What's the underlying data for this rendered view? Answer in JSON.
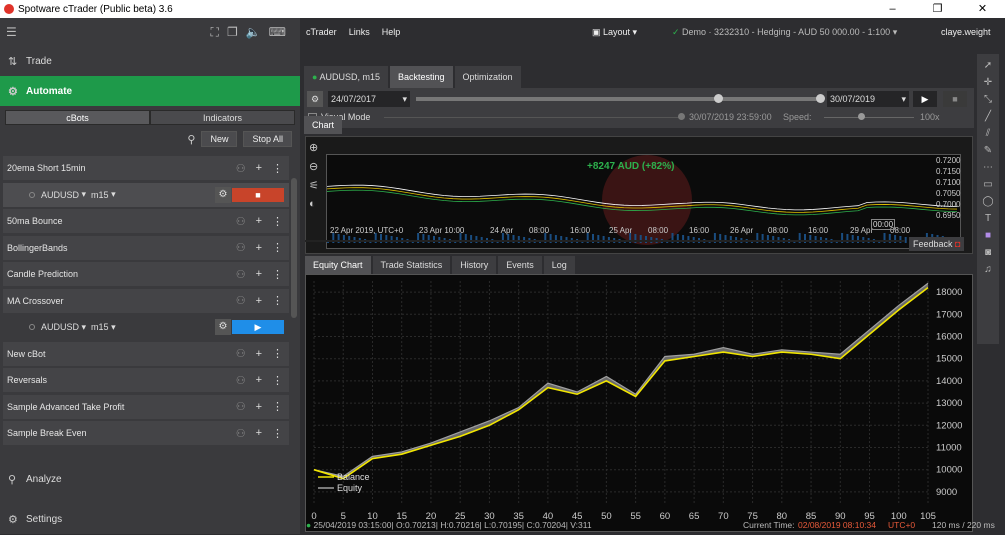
{
  "window": {
    "title": "Spotware cTrader (Public beta) 3.6",
    "minimize": "–",
    "maximize": "❐",
    "close": "✕"
  },
  "left": {
    "nav": {
      "trade": "Trade",
      "automate": "Automate",
      "analyze": "Analyze",
      "settings": "Settings"
    },
    "subtabs": [
      "cBots",
      "Indicators"
    ],
    "new_btn": "New",
    "stop_all_btn": "Stop All",
    "bots": [
      {
        "name": "20ema Short 15min"
      },
      {
        "instance": true,
        "symbol": "AUDUSD",
        "tf": "m15",
        "state": "running",
        "btn": "■",
        "color": "#c8442a"
      },
      {
        "name": "50ma Bounce"
      },
      {
        "name": "BollingerBands"
      },
      {
        "name": "Candle Prediction"
      },
      {
        "name": "MA Crossover"
      },
      {
        "instance": true,
        "symbol": "AUDUSD",
        "tf": "m15",
        "state": "stopped",
        "btn": "▶",
        "color": "#1f8ee8"
      },
      {
        "name": "New cBot"
      },
      {
        "name": "Reversals"
      },
      {
        "name": "Sample Advanced Take Profit"
      },
      {
        "name": "Sample Break Even"
      }
    ]
  },
  "menu": {
    "items": [
      "cTrader",
      "Links",
      "Help"
    ],
    "layout": "Layout",
    "account": "Demo · 3232310 - Hedging - AUD 50 000.00 - 1:100",
    "user": "claye.weight"
  },
  "tabs": {
    "symbol": "AUDUSD, m15",
    "backtesting": "Backtesting",
    "optimization": "Optimization"
  },
  "backtest": {
    "start_date": "24/07/2017",
    "end_date": "30/07/2019",
    "visual_mode": "Visual Mode",
    "current": "30/07/2019 23:59:00",
    "speed_label": "Speed:",
    "speed": "100x"
  },
  "chart": {
    "tab": "Chart",
    "profit": "+8247 AUD (+82%)",
    "y_ticks": [
      "0.7200",
      "0.7150",
      "0.7100",
      "0.7050",
      "0.7000",
      "0.6950"
    ],
    "x_ticks": [
      "22 Apr 2019, UTC+0",
      "23 Apr 10:00",
      "24 Apr",
      "08:00",
      "16:00",
      "25 Apr",
      "08:00",
      "16:00",
      "26 Apr",
      "08:00",
      "16:00",
      "29 Apr",
      "08:00"
    ],
    "marker": "00:00"
  },
  "bottom_tabs": [
    "Equity Chart",
    "Trade Statistics",
    "History",
    "Events",
    "Log"
  ],
  "feedback": "Feedback",
  "chart_data": {
    "type": "line",
    "title": "",
    "x": [
      0,
      5,
      10,
      15,
      20,
      25,
      30,
      35,
      40,
      45,
      50,
      55,
      60,
      65,
      70,
      75,
      80,
      85,
      90,
      95,
      100,
      105
    ],
    "xlim": [
      0,
      105
    ],
    "ylim": [
      8500,
      18500
    ],
    "y_ticks": [
      9000,
      10000,
      11000,
      12000,
      13000,
      14000,
      15000,
      16000,
      17000,
      18000
    ],
    "series": [
      {
        "name": "Balance",
        "color": "#f2e600",
        "values": [
          10000,
          9600,
          10500,
          10700,
          11100,
          11500,
          12000,
          12700,
          13700,
          13400,
          14000,
          13300,
          14900,
          15100,
          15300,
          15100,
          15300,
          15200,
          15000,
          16100,
          17200,
          18200
        ]
      },
      {
        "name": "Equity",
        "color": "#a0a0a0",
        "values": [
          10000,
          9700,
          10600,
          10800,
          11200,
          11700,
          12200,
          12800,
          13900,
          13500,
          14200,
          13400,
          15100,
          15200,
          15500,
          15200,
          15400,
          15300,
          15200,
          16300,
          17400,
          18400
        ]
      }
    ],
    "legend": "bottom-left",
    "grid": true
  },
  "status": {
    "bar": "25/04/2019 03:15:00| O:0.70213| H:0.70216| L:0.70195| C:0.70204| V:311",
    "time_label": "Current Time:",
    "time": "02/08/2019 08:10:34",
    "tz": "UTC+0",
    "latency": "120 ms / 220 ms"
  }
}
